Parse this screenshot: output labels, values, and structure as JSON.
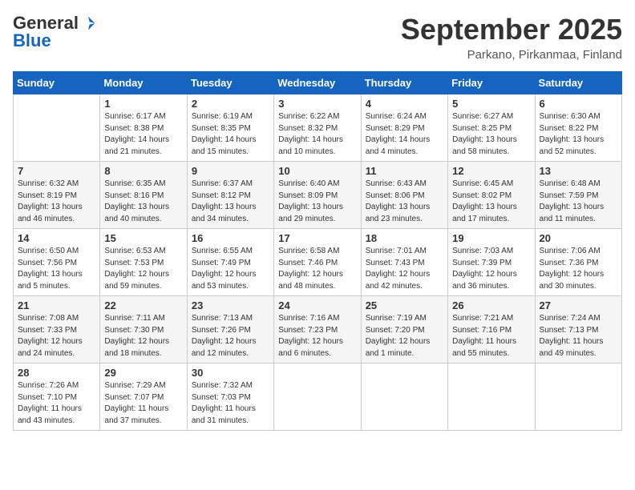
{
  "logo": {
    "general": "General",
    "blue": "Blue"
  },
  "header": {
    "month_year": "September 2025",
    "location": "Parkano, Pirkanmaa, Finland"
  },
  "weekdays": [
    "Sunday",
    "Monday",
    "Tuesday",
    "Wednesday",
    "Thursday",
    "Friday",
    "Saturday"
  ],
  "weeks": [
    [
      {
        "day": "",
        "info": ""
      },
      {
        "day": "1",
        "info": "Sunrise: 6:17 AM\nSunset: 8:38 PM\nDaylight: 14 hours\nand 21 minutes."
      },
      {
        "day": "2",
        "info": "Sunrise: 6:19 AM\nSunset: 8:35 PM\nDaylight: 14 hours\nand 15 minutes."
      },
      {
        "day": "3",
        "info": "Sunrise: 6:22 AM\nSunset: 8:32 PM\nDaylight: 14 hours\nand 10 minutes."
      },
      {
        "day": "4",
        "info": "Sunrise: 6:24 AM\nSunset: 8:29 PM\nDaylight: 14 hours\nand 4 minutes."
      },
      {
        "day": "5",
        "info": "Sunrise: 6:27 AM\nSunset: 8:25 PM\nDaylight: 13 hours\nand 58 minutes."
      },
      {
        "day": "6",
        "info": "Sunrise: 6:30 AM\nSunset: 8:22 PM\nDaylight: 13 hours\nand 52 minutes."
      }
    ],
    [
      {
        "day": "7",
        "info": "Sunrise: 6:32 AM\nSunset: 8:19 PM\nDaylight: 13 hours\nand 46 minutes."
      },
      {
        "day": "8",
        "info": "Sunrise: 6:35 AM\nSunset: 8:16 PM\nDaylight: 13 hours\nand 40 minutes."
      },
      {
        "day": "9",
        "info": "Sunrise: 6:37 AM\nSunset: 8:12 PM\nDaylight: 13 hours\nand 34 minutes."
      },
      {
        "day": "10",
        "info": "Sunrise: 6:40 AM\nSunset: 8:09 PM\nDaylight: 13 hours\nand 29 minutes."
      },
      {
        "day": "11",
        "info": "Sunrise: 6:43 AM\nSunset: 8:06 PM\nDaylight: 13 hours\nand 23 minutes."
      },
      {
        "day": "12",
        "info": "Sunrise: 6:45 AM\nSunset: 8:02 PM\nDaylight: 13 hours\nand 17 minutes."
      },
      {
        "day": "13",
        "info": "Sunrise: 6:48 AM\nSunset: 7:59 PM\nDaylight: 13 hours\nand 11 minutes."
      }
    ],
    [
      {
        "day": "14",
        "info": "Sunrise: 6:50 AM\nSunset: 7:56 PM\nDaylight: 13 hours\nand 5 minutes."
      },
      {
        "day": "15",
        "info": "Sunrise: 6:53 AM\nSunset: 7:53 PM\nDaylight: 12 hours\nand 59 minutes."
      },
      {
        "day": "16",
        "info": "Sunrise: 6:55 AM\nSunset: 7:49 PM\nDaylight: 12 hours\nand 53 minutes."
      },
      {
        "day": "17",
        "info": "Sunrise: 6:58 AM\nSunset: 7:46 PM\nDaylight: 12 hours\nand 48 minutes."
      },
      {
        "day": "18",
        "info": "Sunrise: 7:01 AM\nSunset: 7:43 PM\nDaylight: 12 hours\nand 42 minutes."
      },
      {
        "day": "19",
        "info": "Sunrise: 7:03 AM\nSunset: 7:39 PM\nDaylight: 12 hours\nand 36 minutes."
      },
      {
        "day": "20",
        "info": "Sunrise: 7:06 AM\nSunset: 7:36 PM\nDaylight: 12 hours\nand 30 minutes."
      }
    ],
    [
      {
        "day": "21",
        "info": "Sunrise: 7:08 AM\nSunset: 7:33 PM\nDaylight: 12 hours\nand 24 minutes."
      },
      {
        "day": "22",
        "info": "Sunrise: 7:11 AM\nSunset: 7:30 PM\nDaylight: 12 hours\nand 18 minutes."
      },
      {
        "day": "23",
        "info": "Sunrise: 7:13 AM\nSunset: 7:26 PM\nDaylight: 12 hours\nand 12 minutes."
      },
      {
        "day": "24",
        "info": "Sunrise: 7:16 AM\nSunset: 7:23 PM\nDaylight: 12 hours\nand 6 minutes."
      },
      {
        "day": "25",
        "info": "Sunrise: 7:19 AM\nSunset: 7:20 PM\nDaylight: 12 hours\nand 1 minute."
      },
      {
        "day": "26",
        "info": "Sunrise: 7:21 AM\nSunset: 7:16 PM\nDaylight: 11 hours\nand 55 minutes."
      },
      {
        "day": "27",
        "info": "Sunrise: 7:24 AM\nSunset: 7:13 PM\nDaylight: 11 hours\nand 49 minutes."
      }
    ],
    [
      {
        "day": "28",
        "info": "Sunrise: 7:26 AM\nSunset: 7:10 PM\nDaylight: 11 hours\nand 43 minutes."
      },
      {
        "day": "29",
        "info": "Sunrise: 7:29 AM\nSunset: 7:07 PM\nDaylight: 11 hours\nand 37 minutes."
      },
      {
        "day": "30",
        "info": "Sunrise: 7:32 AM\nSunset: 7:03 PM\nDaylight: 11 hours\nand 31 minutes."
      },
      {
        "day": "",
        "info": ""
      },
      {
        "day": "",
        "info": ""
      },
      {
        "day": "",
        "info": ""
      },
      {
        "day": "",
        "info": ""
      }
    ]
  ]
}
